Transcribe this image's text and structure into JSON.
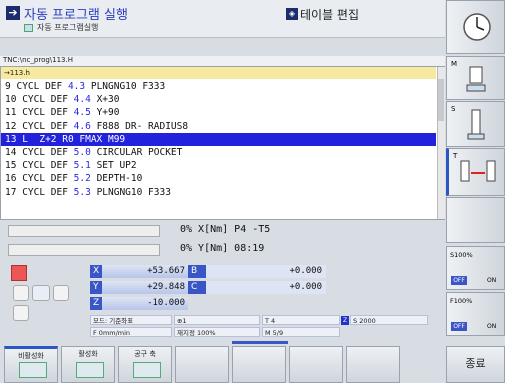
{
  "header": {
    "mode_title": "자동 프로그램 실행",
    "mode_subtitle": "자동 프로그램실행",
    "table_mode": "테이블 편집"
  },
  "program": {
    "path": "TNC:\\nc_prog\\113.H",
    "file": "→113.h",
    "lines": [
      {
        "no": "9",
        "pre": "CYCL DEF ",
        "num": "4.3",
        "post": " PLNGNG10 F333"
      },
      {
        "no": "10",
        "pre": "CYCL DEF ",
        "num": "4.4",
        "post": " X+30"
      },
      {
        "no": "11",
        "pre": "CYCL DEF ",
        "num": "4.5",
        "post": " Y+90"
      },
      {
        "no": "12",
        "pre": "CYCL DEF ",
        "num": "4.6",
        "post": " F888 DR- RADIUS8"
      },
      {
        "no": "13",
        "pre": "L  Z+2 R0 FMAX M99",
        "num": "",
        "post": ""
      },
      {
        "no": "14",
        "pre": "CYCL DEF ",
        "num": "5.0",
        "post": " CIRCULAR POCKET"
      },
      {
        "no": "15",
        "pre": "CYCL DEF ",
        "num": "5.1",
        "post": " SET UP2"
      },
      {
        "no": "16",
        "pre": "CYCL DEF ",
        "num": "5.2",
        "post": " DEPTH-10"
      },
      {
        "no": "17",
        "pre": "CYCL DEF ",
        "num": "5.3",
        "post": " PLNGNG10 F333"
      }
    ],
    "active_line": "13"
  },
  "override": {
    "row1": "0% X[Nm] P4  -T5",
    "row2": "0% Y[Nm] 08:19"
  },
  "position": {
    "x_label": "X",
    "x_value": "+53.667",
    "y_label": "Y",
    "y_value": "+29.848",
    "z_label": "Z",
    "z_value": "-10.000",
    "b_label": "B",
    "b_value": "+0.000",
    "c_label": "C",
    "c_value": "+0.000",
    "mode": "모드: 기준좌표",
    "feed": "F 0mm/min",
    "override_label": "재지정 100%",
    "tool": "T 4",
    "spindle_axis": "Z",
    "spindle": "S 2000",
    "m_func": "M 5/9"
  },
  "right_panel": {
    "s_override": "S100%",
    "s_off": "OFF",
    "s_on": "ON",
    "f_override": "F100%",
    "f_off": "OFF",
    "f_on": "ON"
  },
  "softkeys": {
    "k1": "비활성화",
    "k2": "활성화",
    "k3": "공구 축",
    "end": "종료"
  }
}
